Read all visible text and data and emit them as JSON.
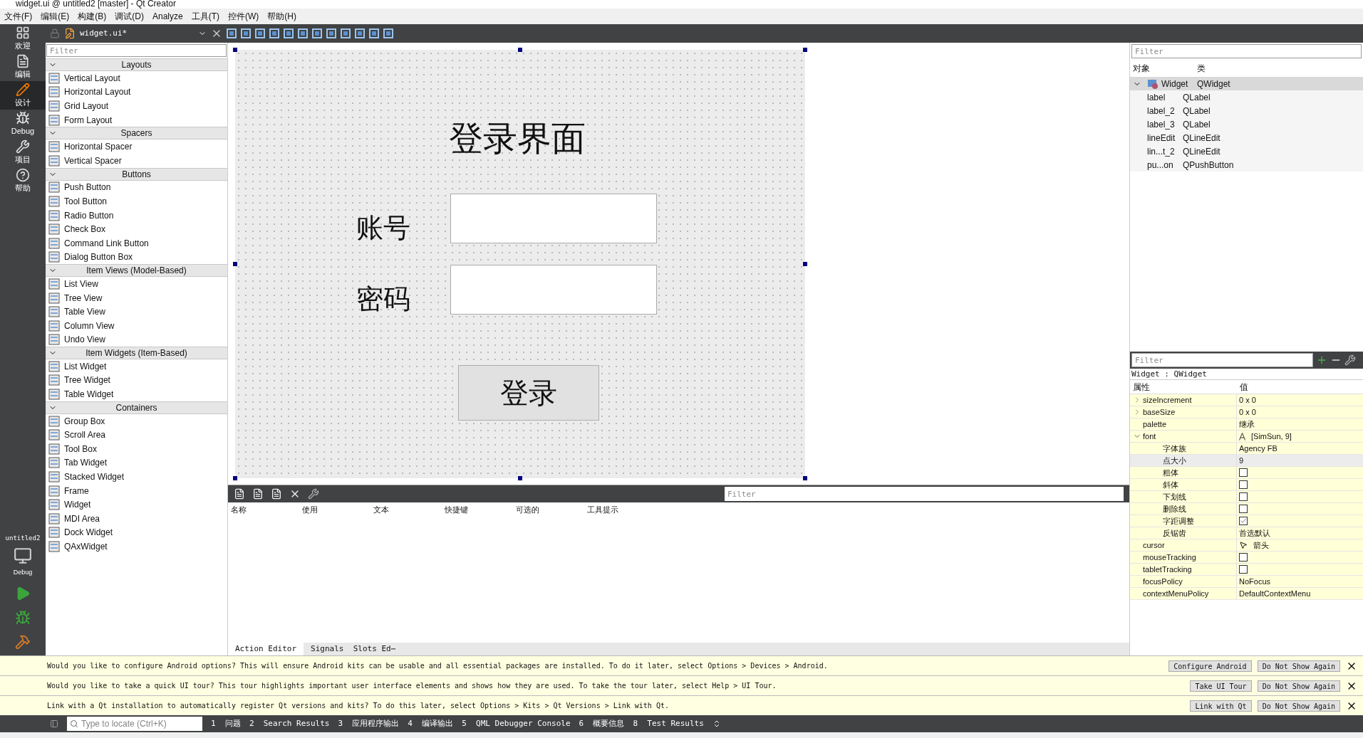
{
  "window": {
    "title": "widget.ui @ untitled2 [master] - Qt Creator"
  },
  "menu": [
    "文件(F)",
    "编辑(E)",
    "构建(B)",
    "调试(D)",
    "Analyze",
    "工具(T)",
    "控件(W)",
    "帮助(H)"
  ],
  "modes": [
    {
      "label": "欢迎",
      "selected": false
    },
    {
      "label": "编辑",
      "selected": false
    },
    {
      "label": "设计",
      "selected": true
    },
    {
      "label": "Debug",
      "selected": false
    },
    {
      "label": "项目",
      "selected": false
    },
    {
      "label": "帮助",
      "selected": false
    }
  ],
  "target": {
    "project": "untitled2",
    "config": "Debug"
  },
  "editor_toolbar": {
    "file": "widget.ui*"
  },
  "widget_box": {
    "placeholder": "Filter",
    "categories": [
      {
        "name": "Layouts",
        "expanded": true,
        "items": [
          "Vertical Layout",
          "Horizontal Layout",
          "Grid Layout",
          "Form Layout"
        ]
      },
      {
        "name": "Spacers",
        "expanded": true,
        "items": [
          "Horizontal Spacer",
          "Vertical Spacer"
        ]
      },
      {
        "name": "Buttons",
        "expanded": true,
        "items": [
          "Push Button",
          "Tool Button",
          "Radio Button",
          "Check Box",
          "Command Link Button",
          "Dialog Button Box"
        ]
      },
      {
        "name": "Item Views (Model-Based)",
        "expanded": true,
        "items": [
          "List View",
          "Tree View",
          "Table View",
          "Column View",
          "Undo View"
        ]
      },
      {
        "name": "Item Widgets (Item-Based)",
        "expanded": true,
        "items": [
          "List Widget",
          "Tree Widget",
          "Table Widget"
        ]
      },
      {
        "name": "Containers",
        "expanded": true,
        "items": [
          "Group Box",
          "Scroll Area",
          "Tool Box",
          "Tab Widget",
          "Stacked Widget",
          "Frame",
          "Widget",
          "MDI Area",
          "Dock Widget",
          "QAxWidget"
        ]
      }
    ]
  },
  "form": {
    "title": "登录界面",
    "account_label": "账号",
    "password_label": "密码",
    "login_button": "登录"
  },
  "action_editor": {
    "placeholder": "Filter",
    "columns": [
      "名称",
      "使用",
      "文本",
      "快捷键",
      "可选的",
      "工具提示"
    ],
    "tabs": [
      {
        "label": "Action Editor",
        "selected": true
      },
      {
        "label": "Signals  Slots Ed⋯",
        "selected": false
      }
    ]
  },
  "object_inspector": {
    "placeholder": "Filter",
    "columns": [
      "对象",
      "类"
    ],
    "tree": [
      {
        "name": "Widget",
        "class": "QWidget",
        "selected": true,
        "expanded": true,
        "children": [
          {
            "name": "label",
            "class": "QLabel",
            "selected": false
          },
          {
            "name": "label_2",
            "class": "QLabel",
            "selected": false
          },
          {
            "name": "label_3",
            "class": "QLabel",
            "selected": false
          },
          {
            "name": "lineEdit",
            "class": "QLineEdit",
            "selected": false
          },
          {
            "name": "lin...t_2",
            "class": "QLineEdit",
            "selected": false
          },
          {
            "name": "pu...on",
            "class": "QPushButton",
            "selected": false
          }
        ]
      }
    ]
  },
  "property_editor": {
    "placeholder": "Filter",
    "object": "Widget : QWidget",
    "columns": [
      "属性",
      "值"
    ],
    "properties": [
      {
        "name": "sizeIncrement",
        "kind": "text",
        "value": "0 x 0",
        "expanded": false,
        "selected": false
      },
      {
        "name": "baseSize",
        "kind": "text",
        "value": "0 x 0",
        "expanded": false,
        "selected": false
      },
      {
        "name": "palette",
        "kind": "text",
        "value": "继承",
        "selected": false
      },
      {
        "name": "font",
        "kind": "font",
        "value": "[SimSun, 9]",
        "expanded": true,
        "selected": false,
        "children": [
          {
            "name": "字体族",
            "kind": "text",
            "value": "Agency FB",
            "selected": false
          },
          {
            "name": "点大小",
            "kind": "text",
            "value": "9",
            "selected": true
          },
          {
            "name": "粗体",
            "kind": "checkbox",
            "checked": false,
            "selected": false
          },
          {
            "name": "斜体",
            "kind": "checkbox",
            "checked": false,
            "selected": false
          },
          {
            "name": "下划线",
            "kind": "checkbox",
            "checked": false,
            "selected": false
          },
          {
            "name": "删除线",
            "kind": "checkbox",
            "checked": false,
            "selected": false
          },
          {
            "name": "字距调整",
            "kind": "checkbox",
            "checked": true,
            "selected": false
          },
          {
            "name": "反锯齿",
            "kind": "text",
            "value": "首选默认",
            "selected": false
          }
        ]
      },
      {
        "name": "cursor",
        "kind": "cursor",
        "value": "箭头",
        "selected": false
      },
      {
        "name": "mouseTracking",
        "kind": "checkbox",
        "checked": false,
        "selected": false
      },
      {
        "name": "tabletTracking",
        "kind": "checkbox",
        "checked": false,
        "selected": false
      },
      {
        "name": "focusPolicy",
        "kind": "text",
        "value": "NoFocus",
        "selected": false
      },
      {
        "name": "contextMenuPolicy",
        "kind": "text",
        "value": "DefaultContextMenu",
        "selected": false
      }
    ]
  },
  "info_bars": [
    {
      "text": "Would you like to configure Android options? This will ensure Android kits can be usable and all essential packages are installed. To do it later, select Options > Devices > Android.",
      "buttons": [
        "Configure Android",
        "Do Not Show Again"
      ]
    },
    {
      "text": "Would you like to take a quick UI tour? This tour highlights important user interface elements and shows how they are used. To take the tour later, select Help > UI Tour.",
      "buttons": [
        "Take UI Tour",
        "Do Not Show Again"
      ]
    },
    {
      "text": "Link with a Qt installation to automatically register Qt versions and kits? To do this later, select Options > Kits > Qt Versions > Link with Qt.",
      "buttons": [
        "Link with Qt",
        "Do Not Show Again"
      ]
    }
  ],
  "status_bar": {
    "placeholder": "Type to locate (Ctrl+K)",
    "panes": [
      "1  问题",
      "2  Search Results",
      "3  应用程序输出",
      "4  编译输出",
      "5  QML Debugger Console",
      "6  概要信息",
      "8  Test Results"
    ]
  }
}
